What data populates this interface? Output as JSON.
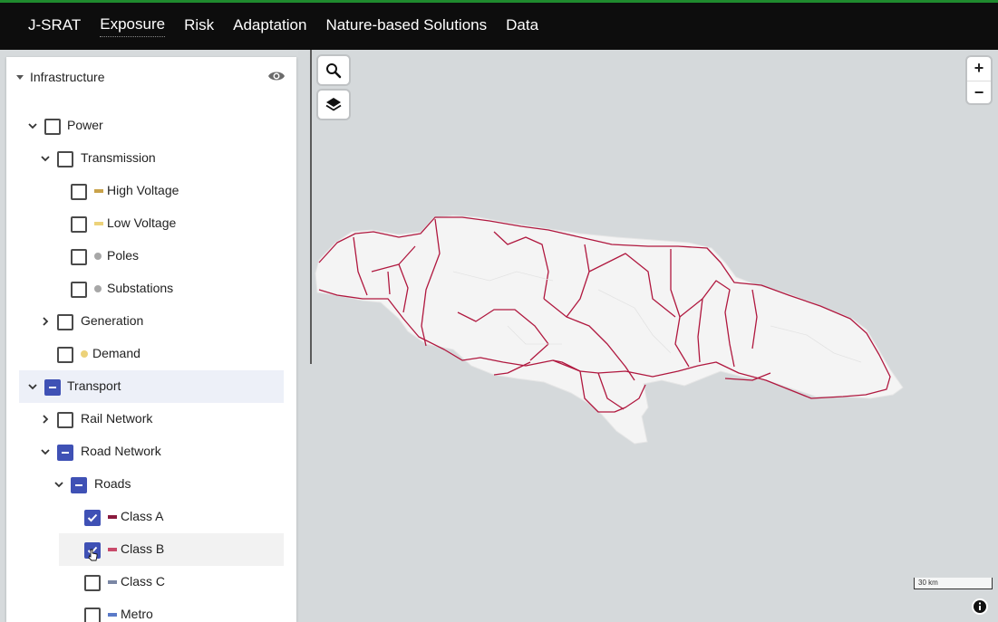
{
  "nav": {
    "brand": "J-SRAT",
    "items": [
      "Exposure",
      "Risk",
      "Adaptation",
      "Nature-based Solutions",
      "Data"
    ]
  },
  "panel": {
    "section_title": "Infrastructure",
    "rows": [
      {
        "label": "Power",
        "state": "unchecked",
        "expand": "expanded"
      },
      {
        "label": "Transmission",
        "state": "unchecked",
        "expand": "expanded"
      },
      {
        "label": "High Voltage",
        "state": "unchecked",
        "swatch": "line",
        "color": "#c9a24a"
      },
      {
        "label": "Low Voltage",
        "state": "unchecked",
        "swatch": "line",
        "color": "#ecd27a"
      },
      {
        "label": "Poles",
        "state": "unchecked",
        "swatch": "dot",
        "color": "#a7a7a7"
      },
      {
        "label": "Substations",
        "state": "unchecked",
        "swatch": "dot",
        "color": "#a7a7a7"
      },
      {
        "label": "Generation",
        "state": "unchecked",
        "expand": "collapsed"
      },
      {
        "label": "Demand",
        "state": "unchecked",
        "swatch": "dot",
        "color": "#ecd27a"
      },
      {
        "label": "Transport",
        "state": "indeterminate",
        "expand": "expanded"
      },
      {
        "label": "Rail Network",
        "state": "unchecked",
        "expand": "collapsed"
      },
      {
        "label": "Road Network",
        "state": "indeterminate",
        "expand": "expanded"
      },
      {
        "label": "Roads",
        "state": "indeterminate",
        "expand": "expanded"
      },
      {
        "label": "Class A",
        "state": "checked",
        "swatch": "line",
        "color": "#8a1a3d"
      },
      {
        "label": "Class B",
        "state": "checked",
        "swatch": "line",
        "color": "#c84a6a"
      },
      {
        "label": "Class C",
        "state": "unchecked",
        "swatch": "line",
        "color": "#7a86a4"
      },
      {
        "label": "Metro",
        "state": "unchecked",
        "swatch": "line",
        "color": "#5a7ac8"
      }
    ]
  },
  "map": {
    "scale_label": "30 km",
    "road_color": "#b0183f",
    "land_color": "#f5f5f5"
  },
  "colors": {
    "accent": "#3f51b5",
    "topbar": "#0d0d0d",
    "topbar_border": "#1f8a2e"
  }
}
